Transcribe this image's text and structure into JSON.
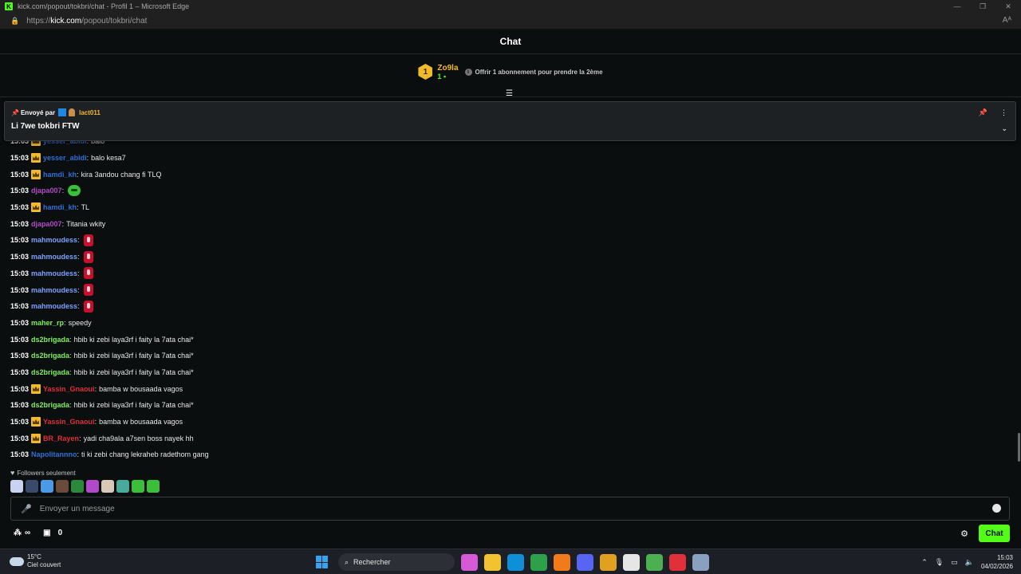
{
  "window": {
    "title": "kick.com/popout/tokbri/chat - Profil 1 – Microsoft Edge",
    "favicon_letter": "K",
    "controls": [
      "minimize-icon",
      "restore-icon",
      "close-icon"
    ]
  },
  "address_bar": {
    "prefix": "https://",
    "host": "kick.com",
    "path": "/popout/tokbri/chat"
  },
  "chat": {
    "title": "Chat",
    "gift": {
      "rank": "1",
      "user": "Zo9la",
      "count": "1",
      "offer_text": "Offrir 1 abonnement pour prendre la 2ème"
    },
    "pinned": {
      "sent_by_label": "Envoyé par",
      "author": "lact011",
      "message": "Li 7we tokbri FTW"
    },
    "messages": [
      {
        "time": "15:03",
        "crown": true,
        "user": "yesser_abidi",
        "color": "#2f6fd6",
        "text": "balo",
        "emote": ""
      },
      {
        "time": "15:03",
        "crown": true,
        "user": "yesser_abidi",
        "color": "#2f6fd6",
        "text": "balo kesa7",
        "emote": ""
      },
      {
        "time": "15:03",
        "crown": true,
        "user": "hamdi_kh",
        "color": "#2f6fd6",
        "text": "kira 3andou chang fi TLQ",
        "emote": ""
      },
      {
        "time": "15:03",
        "crown": false,
        "user": "djapa007",
        "color": "#b24ac8",
        "text": "",
        "emote": "green"
      },
      {
        "time": "15:03",
        "crown": true,
        "user": "hamdi_kh",
        "color": "#2f6fd6",
        "text": "TL",
        "emote": ""
      },
      {
        "time": "15:03",
        "crown": false,
        "user": "djapa007",
        "color": "#b24ac8",
        "text": "Titania wkity",
        "emote": ""
      },
      {
        "time": "15:03",
        "crown": false,
        "user": "mahmoudess",
        "color": "#7ea0ff",
        "text": "",
        "emote": "red"
      },
      {
        "time": "15:03",
        "crown": false,
        "user": "mahmoudess",
        "color": "#7ea0ff",
        "text": "",
        "emote": "red"
      },
      {
        "time": "15:03",
        "crown": false,
        "user": "mahmoudess",
        "color": "#7ea0ff",
        "text": "",
        "emote": "red"
      },
      {
        "time": "15:03",
        "crown": false,
        "user": "mahmoudess",
        "color": "#7ea0ff",
        "text": "",
        "emote": "red"
      },
      {
        "time": "15:03",
        "crown": false,
        "user": "mahmoudess",
        "color": "#7ea0ff",
        "text": "",
        "emote": "red"
      },
      {
        "time": "15:03",
        "crown": false,
        "user": "maher_rp",
        "color": "#7ff05a",
        "text": "speedy",
        "emote": ""
      },
      {
        "time": "15:03",
        "crown": false,
        "user": "ds2brigada",
        "color": "#7ff05a",
        "text": "hbib ki zebi laya3rf i faity la 7ata chai*",
        "emote": ""
      },
      {
        "time": "15:03",
        "crown": false,
        "user": "ds2brigada",
        "color": "#7ff05a",
        "text": "hbib ki zebi laya3rf i faity la 7ata chai*",
        "emote": ""
      },
      {
        "time": "15:03",
        "crown": false,
        "user": "ds2brigada",
        "color": "#7ff05a",
        "text": "hbib ki zebi laya3rf i faity la 7ata chai*",
        "emote": ""
      },
      {
        "time": "15:03",
        "crown": true,
        "user": "Yassin_Gnaoui",
        "color": "#e0303a",
        "text": "bamba w bousaada vagos",
        "emote": ""
      },
      {
        "time": "15:03",
        "crown": false,
        "user": "ds2brigada",
        "color": "#7ff05a",
        "text": "hbib ki zebi laya3rf i faity la 7ata chai*",
        "emote": ""
      },
      {
        "time": "15:03",
        "crown": true,
        "user": "Yassin_Gnaoui",
        "color": "#e0303a",
        "text": "bamba w bousaada vagos",
        "emote": ""
      },
      {
        "time": "15:03",
        "crown": true,
        "user": "BR_Rayen",
        "color": "#e0303a",
        "text": "yadi cha9ala a7sen boss nayek hh",
        "emote": ""
      },
      {
        "time": "15:03",
        "crown": false,
        "user": "Napolitannno",
        "color": "#2f6fd6",
        "text": "ti ki zebi chang lekraheb radethom gang",
        "emote": ""
      }
    ],
    "followers_label": "Followers seulement",
    "recent_emotes": [
      "#c9d2f0",
      "#3a4a6a",
      "#4a9ae8",
      "#6a4a3a",
      "#2a8a3a",
      "#b04ac8",
      "#d8c8b8",
      "#4aaa9a",
      "#3bbf3b",
      "#3bbf3b"
    ],
    "input": {
      "placeholder": "Envoyer un message"
    },
    "points": "∞",
    "store_count": "0",
    "send_label": "Chat"
  },
  "taskbar": {
    "weather_temp": "15°C",
    "weather_desc": "Ciel couvert",
    "search_placeholder": "Rechercher",
    "apps": [
      "#d65ad6",
      "#f2c230",
      "#0f8fd8",
      "#2fa04a",
      "#f27a1a",
      "#5865f2",
      "#e0a020",
      "#e6e6e6",
      "#4caf50",
      "#e0303a",
      "#8aa0c0"
    ],
    "time": "15:03",
    "date": "04/02/2026"
  }
}
